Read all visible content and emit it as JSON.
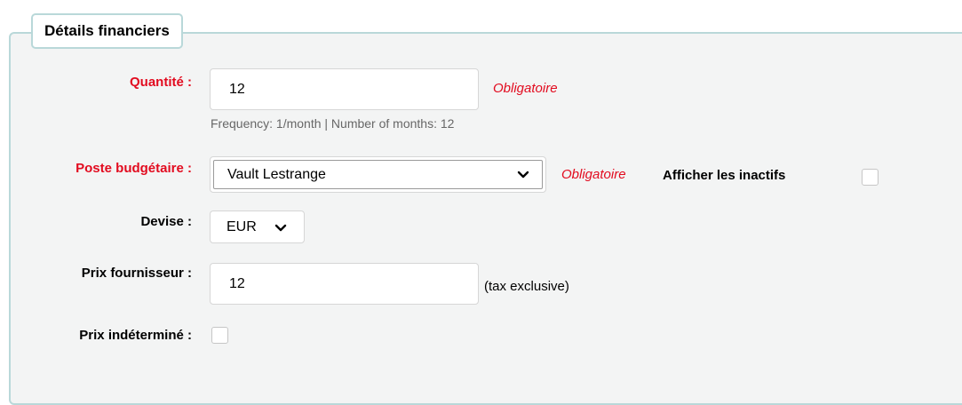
{
  "section": {
    "title": "Détails financiers"
  },
  "quantity": {
    "label": "Quantité :",
    "value": "12",
    "required": "Obligatoire",
    "hint": "Frequency: 1/month | Number of months: 12"
  },
  "budget": {
    "label": "Poste budgétaire :",
    "value": "Vault Lestrange",
    "required": "Obligatoire",
    "show_inactive_label": "Afficher les inactifs",
    "show_inactive_checked": false
  },
  "currency": {
    "label": "Devise :",
    "value": "EUR"
  },
  "vendor_price": {
    "label": "Prix fournisseur :",
    "value": "12",
    "note": "(tax exclusive)"
  },
  "uncertain_price": {
    "label": "Prix indéterminé :",
    "checked": false
  },
  "colors": {
    "required": "#e20b1f",
    "border": "#b9d8d9",
    "panel": "#f3f4f4"
  }
}
